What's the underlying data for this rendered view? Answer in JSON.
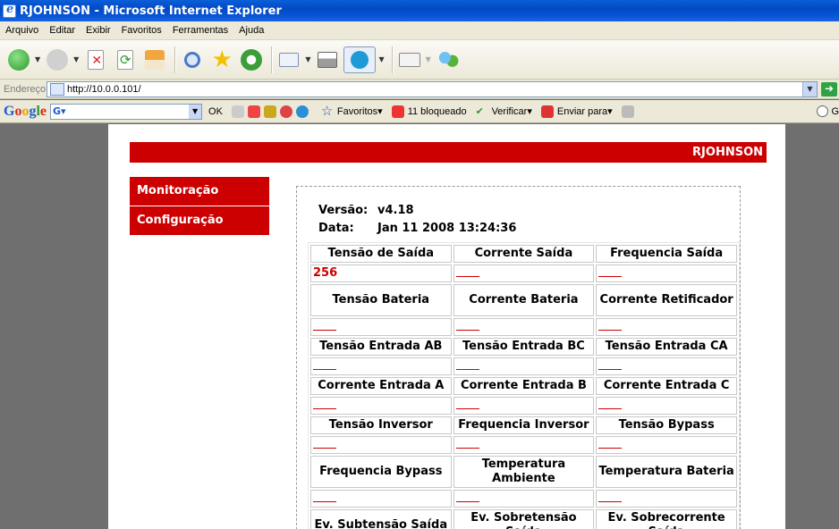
{
  "window": {
    "title": "RJOHNSON - Microsoft Internet Explorer"
  },
  "menubar": [
    "Arquivo",
    "Editar",
    "Exibir",
    "Favoritos",
    "Ferramentas",
    "Ajuda"
  ],
  "address": {
    "label": "Endereço",
    "url": "http://10.0.0.101/"
  },
  "google_toolbar": {
    "logo": "Google",
    "ok": "OK",
    "favoritos": "Favoritos",
    "bloqueado": "11 bloqueado",
    "verificar": "Verificar",
    "enviar": "Enviar para",
    "partial": "G"
  },
  "colors": {
    "brand_red": "#cc0000",
    "xp_blue": "#0a5fd8"
  },
  "page": {
    "header": "RJOHNSON",
    "menu": [
      "Monitoração",
      "Configuração"
    ],
    "version_label": "Versão:",
    "version": "v4.18",
    "date_label": "Data:",
    "date": "Jan 11 2008 13:24:36"
  },
  "grid": {
    "rows": [
      {
        "labels": [
          "Tensão de Saída",
          "Corrente Saída",
          "Frequencia Saída"
        ],
        "values": [
          "256",
          "",
          ""
        ]
      },
      {
        "labels": [
          "Tensão Bateria",
          "Corrente Bateria",
          "Corrente Retificador"
        ],
        "values": [
          "",
          "",
          ""
        ]
      },
      {
        "labels": [
          "Tensão Entrada AB",
          "Tensão Entrada BC",
          "Tensão Entrada CA"
        ],
        "values": [
          "",
          "",
          ""
        ]
      },
      {
        "labels": [
          "Corrente Entrada A",
          "Corrente Entrada B",
          "Corrente Entrada C"
        ],
        "values": [
          "",
          "",
          ""
        ]
      },
      {
        "labels": [
          "Tensão Inversor",
          "Frequencia Inversor",
          "Tensão Bypass"
        ],
        "values": [
          "",
          "",
          ""
        ]
      },
      {
        "labels": [
          "Frequencia Bypass",
          "Temperatura Ambiente",
          "Temperatura Bateria"
        ],
        "values": [
          "",
          "",
          ""
        ]
      },
      {
        "labels": [
          "Ev. Subtensão Saída",
          "Ev. Sobretensão Saída",
          "Ev. Sobrecorrente Saída"
        ],
        "values": []
      }
    ]
  }
}
